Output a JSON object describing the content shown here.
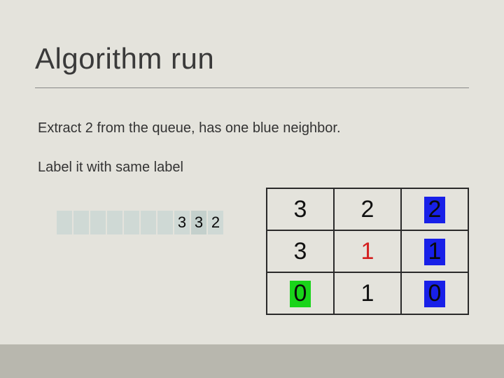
{
  "title": "Algorithm run",
  "body": {
    "line1": "Extract 2 from the queue, has one blue neighbor.",
    "line2": "Label it with same label"
  },
  "queue": {
    "cells": [
      {
        "v": "",
        "class": "empty"
      },
      {
        "v": "",
        "class": "empty"
      },
      {
        "v": "",
        "class": "empty"
      },
      {
        "v": "",
        "class": "empty"
      },
      {
        "v": "",
        "class": "empty"
      },
      {
        "v": "",
        "class": "empty"
      },
      {
        "v": "",
        "class": "empty"
      },
      {
        "v": "3",
        "class": ""
      },
      {
        "v": "3",
        "class": "highlight"
      },
      {
        "v": "2",
        "class": ""
      }
    ]
  },
  "grid": {
    "rows": [
      [
        {
          "text": "3",
          "style": "black"
        },
        {
          "text": "2",
          "style": "black"
        },
        {
          "text": "2",
          "style": "blue-bg"
        }
      ],
      [
        {
          "text": "3",
          "style": "black"
        },
        {
          "text": "1",
          "style": "red"
        },
        {
          "text": "1",
          "style": "blue-bg"
        }
      ],
      [
        {
          "text": "0",
          "style": "green-bg"
        },
        {
          "text": "1",
          "style": "black"
        },
        {
          "text": "0",
          "style": "blue-bg"
        }
      ]
    ]
  },
  "colors": {
    "background": "#e4e3dc",
    "queue_cell": "#cfd9d5",
    "footer": "#b8b7ae",
    "red": "#d42020",
    "blue": "#1820e8",
    "green": "#19d41a"
  }
}
